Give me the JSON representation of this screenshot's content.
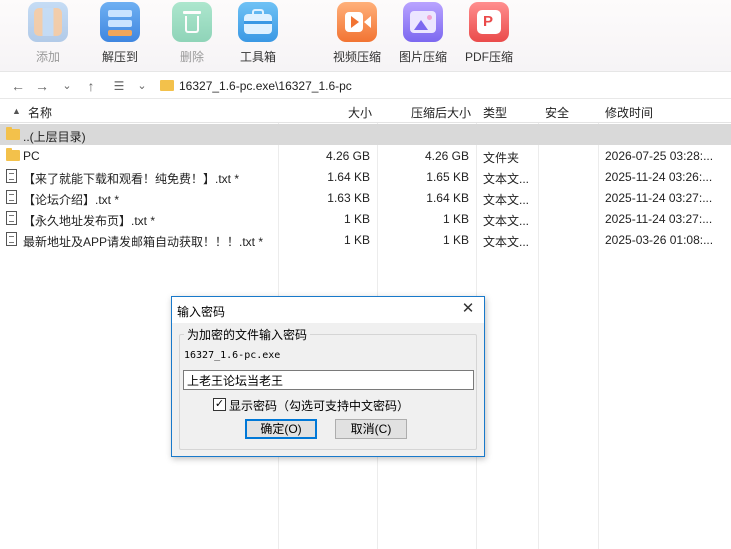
{
  "toolbar": {
    "buttons": [
      {
        "label": "添加",
        "icon": "add-archive-icon",
        "enabled": false
      },
      {
        "label": "解压到",
        "icon": "extract-to-icon",
        "enabled": true
      },
      {
        "label": "删除",
        "icon": "delete-recycle-icon",
        "enabled": false
      },
      {
        "label": "工具箱",
        "icon": "toolbox-icon",
        "enabled": true
      },
      {
        "label": "视频压缩",
        "icon": "video-compress-icon",
        "enabled": true
      },
      {
        "label": "图片压缩",
        "icon": "image-compress-icon",
        "enabled": true
      },
      {
        "label": "PDF压缩",
        "icon": "pdf-compress-icon",
        "enabled": true
      }
    ]
  },
  "address": {
    "path": "16327_1.6-pc.exe\\16327_1.6-pc"
  },
  "list": {
    "columns": {
      "name": "名称",
      "size": "大小",
      "packed": "压缩后大小",
      "type": "类型",
      "security": "安全",
      "modified": "修改时间"
    },
    "rows": [
      {
        "name": "..(上层目录)",
        "size": "",
        "packed": "",
        "type": "",
        "security": "",
        "modified": "",
        "icon": "folder-icon",
        "selected": true
      },
      {
        "name": "PC",
        "size": "4.26 GB",
        "packed": "4.26 GB",
        "type": "文件夹",
        "security": "",
        "modified": "2026-07-25 03:28:...",
        "icon": "folder-icon",
        "selected": false
      },
      {
        "name": "【来了就能下载和观看！纯免费！】.txt *",
        "size": "1.64 KB",
        "packed": "1.65 KB",
        "type": "文本文...",
        "security": "",
        "modified": "2025-11-24 03:26:...",
        "icon": "text-file-icon",
        "selected": false
      },
      {
        "name": "【论坛介绍】.txt *",
        "size": "1.63 KB",
        "packed": "1.64 KB",
        "type": "文本文...",
        "security": "",
        "modified": "2025-11-24 03:27:...",
        "icon": "text-file-icon",
        "selected": false
      },
      {
        "name": "【永久地址发布页】.txt *",
        "size": "1 KB",
        "packed": "1 KB",
        "type": "文本文...",
        "security": "",
        "modified": "2025-11-24 03:27:...",
        "icon": "text-file-icon",
        "selected": false
      },
      {
        "name": "最新地址及APP请发邮箱自动获取！！！.txt *",
        "size": "1 KB",
        "packed": "1 KB",
        "type": "文本文...",
        "security": "",
        "modified": "2025-03-26 01:08:...",
        "icon": "text-file-icon",
        "selected": false
      }
    ]
  },
  "dialog": {
    "title": "输入密码",
    "group_label": "为加密的文件输入密码",
    "file_name": "16327_1.6-pc.exe",
    "password_value": "上老王论坛当老王",
    "show_password_label": "显示密码（勾选可支持中文密码）",
    "show_password_checked": true,
    "ok_label": "确定(O)",
    "cancel_label": "取消(C)"
  }
}
